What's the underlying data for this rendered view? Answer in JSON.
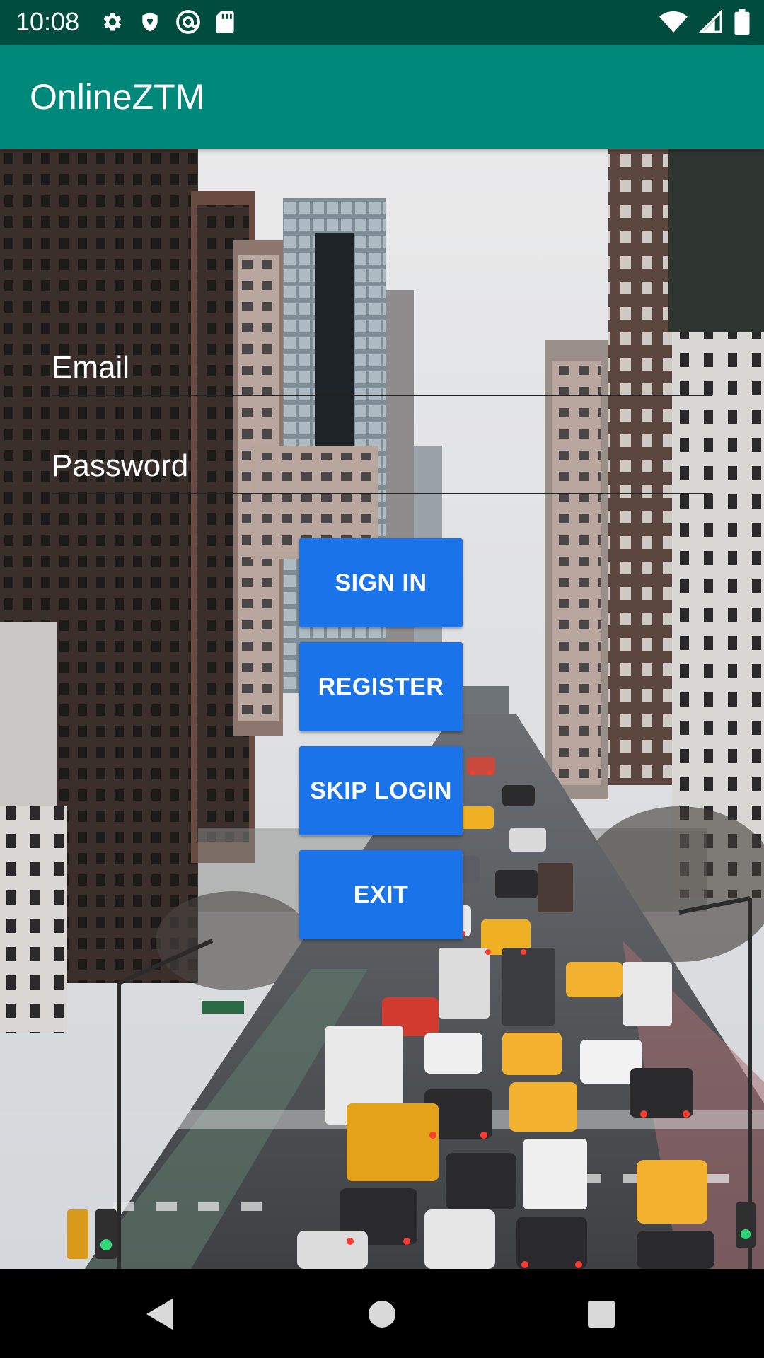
{
  "status_bar": {
    "time": "10:08",
    "left_icons": [
      "settings-icon",
      "shield-icon",
      "at-sign-icon",
      "sd-card-icon"
    ],
    "right_icons": [
      "wifi-icon",
      "cellular-signal-icon",
      "battery-icon"
    ]
  },
  "app_bar": {
    "title": "OnlineZTM"
  },
  "background": {
    "icon": "city-street-traffic-photo"
  },
  "form": {
    "email": {
      "placeholder": "Email",
      "value": ""
    },
    "password": {
      "placeholder": "Password",
      "value": ""
    }
  },
  "buttons": {
    "sign_in": "SIGN IN",
    "register": "REGISTER",
    "skip_login": "SKIP LOGIN",
    "exit": "EXIT"
  },
  "nav_bar": {
    "icons": [
      "back-icon",
      "home-icon",
      "recent-apps-icon"
    ]
  },
  "colors": {
    "status_bar": "#004d40",
    "app_bar": "#00897b",
    "button": "#1a73e8",
    "nav_bar": "#000000"
  }
}
